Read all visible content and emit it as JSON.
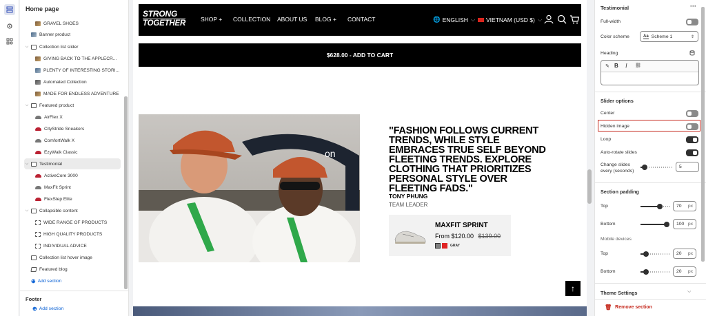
{
  "sidebar": {
    "title": "Home page",
    "items": [
      {
        "label": "GRAVEL SHOES",
        "indent": 2,
        "icon": "image-thumb-icon"
      },
      {
        "label": "Banner product",
        "indent": 1,
        "icon": "image-thumb-icon"
      },
      {
        "label": "Collection list slider",
        "indent": 0,
        "icon": "section-icon"
      },
      {
        "label": "GIVING BACK TO THE APPLECR...",
        "indent": 2,
        "icon": "image-thumb-icon"
      },
      {
        "label": "PLENTY OF INTERESTING STORI...",
        "indent": 2,
        "icon": "image-thumb-icon"
      },
      {
        "label": "Automated Collection",
        "indent": 2,
        "icon": "image-thumb-icon"
      },
      {
        "label": "MADE FOR ENDLESS ADVENTURE",
        "indent": 2,
        "icon": "image-thumb-icon"
      },
      {
        "label": "Featured product",
        "indent": 0,
        "icon": "section-icon"
      },
      {
        "label": "AirFlex X",
        "indent": 2,
        "icon": "shoe-icon"
      },
      {
        "label": "CityStride Sneakers",
        "indent": 2,
        "icon": "shoe-icon"
      },
      {
        "label": "ComfortWalk X",
        "indent": 2,
        "icon": "shoe-icon"
      },
      {
        "label": "EzyWalk Classic",
        "indent": 2,
        "icon": "shoe-icon"
      },
      {
        "label": "Testimonial",
        "indent": 0,
        "icon": "section-icon"
      },
      {
        "label": "ActiveCore 3000",
        "indent": 2,
        "icon": "shoe-icon"
      },
      {
        "label": "MaxFit Sprint",
        "indent": 2,
        "icon": "shoe-icon"
      },
      {
        "label": "FlexStep Elite",
        "indent": 2,
        "icon": "shoe-icon"
      },
      {
        "label": "Collapsible content",
        "indent": 0,
        "icon": "section-icon"
      },
      {
        "label": "WIDE RANGE OF PRODUCTS",
        "indent": 2,
        "icon": "block-icon"
      },
      {
        "label": "HIGH QUALITY PRODUCTS",
        "indent": 2,
        "icon": "block-icon"
      },
      {
        "label": "INDIVIDUAL ADVICE",
        "indent": 2,
        "icon": "block-icon"
      },
      {
        "label": "Collection list hover image",
        "indent": 1,
        "icon": "section-icon"
      },
      {
        "label": "Featured blog",
        "indent": 1,
        "icon": "blog-icon"
      },
      {
        "label": "Add section",
        "indent": 1,
        "icon": "add-icon"
      }
    ],
    "footer_title": "Footer",
    "footer_add": "Add section"
  },
  "preview": {
    "logo_line1": "STRONG",
    "logo_line2": "TOGETHER",
    "nav": [
      "SHOP +",
      "COLLECTION",
      "ABOUT US",
      "BLOG +",
      "CONTACT"
    ],
    "language": "ENGLISH",
    "currency": "VIETNAM (USD $)",
    "cart_button": "$628.00 - ADD TO CART",
    "quote": "\"FASHION FOLLOWS CURRENT TRENDS, WHILE STYLE EMBRACES TRUE SELF BEYOND FLEETING TRENDS. EXPLORE CLOTHING THAT PRIORITIZES PERSONAL STYLE OVER FLEETING FADS.\"",
    "author": "TONY PHUNG",
    "role": "TEAM LEADER",
    "product": {
      "name": "MAXFIT SPRINT",
      "price": "From $120.00",
      "compare_price": "$139.00",
      "swatch_label": "GRAY",
      "swatches": [
        "#808080",
        "#e02424"
      ]
    },
    "back_to_top": "↑"
  },
  "panel": {
    "title": "Testimonial",
    "more": "···",
    "full_width": "Full-width",
    "full_width_on": false,
    "color_scheme_label": "Color scheme",
    "color_scheme_value": "Scheme 1",
    "heading_label": "Heading",
    "slider_options": "Slider options",
    "center": "Center",
    "center_on": false,
    "hidden_image": "Hidden image",
    "hidden_image_on": false,
    "loop": "Loop",
    "loop_on": true,
    "autorotate": "Auto-rotate slides",
    "autorotate_on": true,
    "change_slides_1": "Change slides",
    "change_slides_2": "every (seconds)",
    "change_slides_value": "5",
    "section_padding": "Section padding",
    "top_label": "Top",
    "top_value": "70",
    "bottom_label": "Bottom",
    "bottom_value": "100",
    "mobile_devices": "Mobile devices",
    "m_top_label": "Top",
    "m_top_value": "20",
    "m_bottom_label": "Bottom",
    "m_bottom_value": "20",
    "unit": "px",
    "theme_settings": "Theme Settings",
    "remove_section": "Remove section",
    "accent_red": "#c5281c",
    "highlight_border": "#c5281c"
  }
}
